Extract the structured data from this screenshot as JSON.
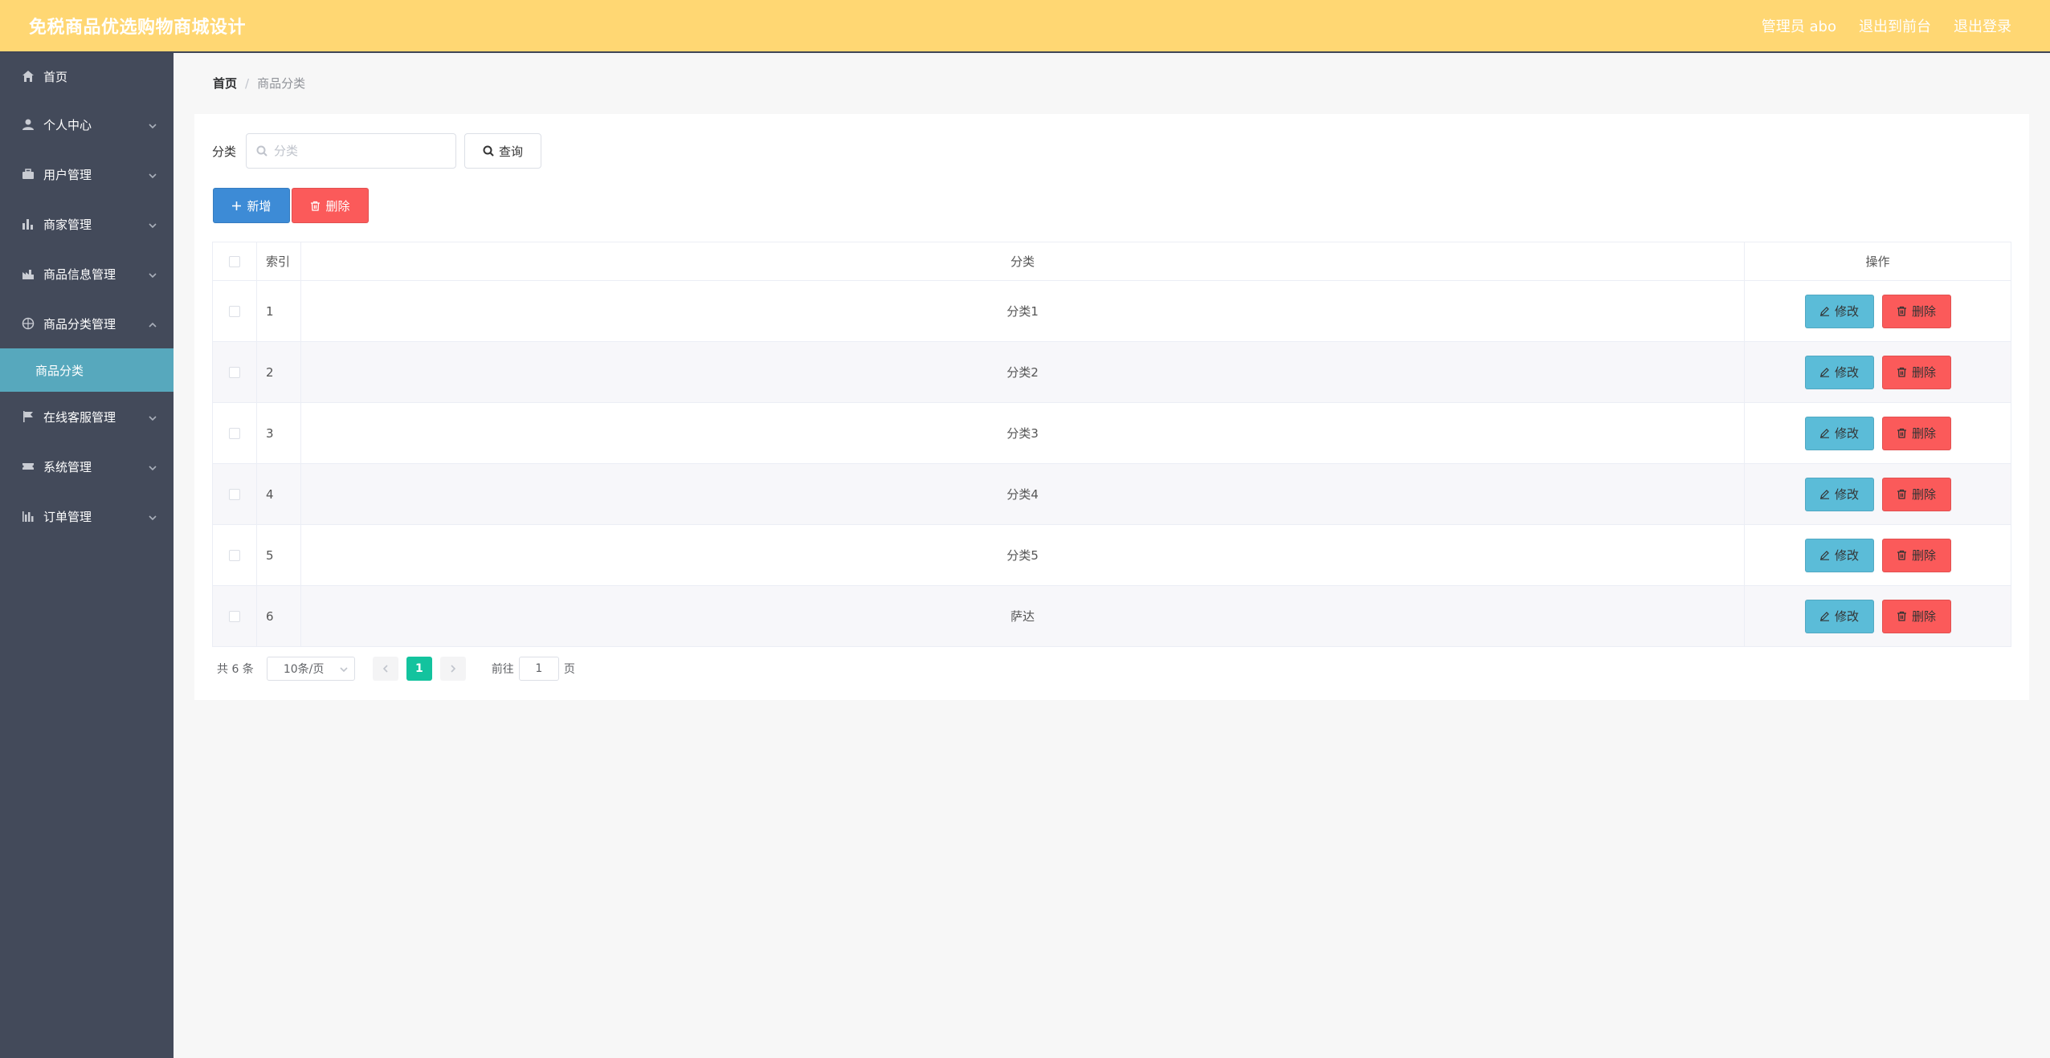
{
  "header": {
    "title": "免税商品优选购物商城设计",
    "admin_label": "管理员 abo",
    "back_to_front": "退出到前台",
    "logout": "退出登录"
  },
  "sidebar": {
    "items": [
      {
        "label": "首页",
        "icon": "home-icon"
      },
      {
        "label": "个人中心",
        "icon": "user-icon"
      },
      {
        "label": "用户管理",
        "icon": "briefcase-icon"
      },
      {
        "label": "商家管理",
        "icon": "bar-chart-icon"
      },
      {
        "label": "商品信息管理",
        "icon": "factory-icon"
      },
      {
        "label": "商品分类管理",
        "icon": "compass-icon"
      },
      {
        "label": "在线客服管理",
        "icon": "flag-icon"
      },
      {
        "label": "系统管理",
        "icon": "ticket-icon"
      },
      {
        "label": "订单管理",
        "icon": "chart-icon"
      }
    ],
    "active_submenu": "商品分类"
  },
  "breadcrumb": {
    "home": "首页",
    "separator": "/",
    "current": "商品分类"
  },
  "search": {
    "label": "分类",
    "placeholder": "分类",
    "value": "",
    "button": "查询"
  },
  "actions": {
    "add": "新增",
    "delete": "删除"
  },
  "table": {
    "headers": {
      "index": "索引",
      "category": "分类",
      "operation": "操作"
    },
    "rows": [
      {
        "index": "1",
        "category": "分类1"
      },
      {
        "index": "2",
        "category": "分类2"
      },
      {
        "index": "3",
        "category": "分类3"
      },
      {
        "index": "4",
        "category": "分类4"
      },
      {
        "index": "5",
        "category": "分类5"
      },
      {
        "index": "6",
        "category": "萨达"
      }
    ],
    "edit_label": "修改",
    "delete_label": "删除"
  },
  "pagination": {
    "total": "共 6 条",
    "page_size": "10条/页",
    "current_page": "1",
    "goto_prefix": "前往",
    "goto_value": "1",
    "goto_suffix": "页"
  },
  "colors": {
    "header_bg": "#ffd773",
    "sidebar_bg": "#434a5a",
    "active_submenu_bg": "#57a8bd",
    "add_button": "#3d8bd6",
    "delete_button": "#fb5a5a",
    "edit_button": "#5bbcd8",
    "current_page": "#13c39e"
  }
}
